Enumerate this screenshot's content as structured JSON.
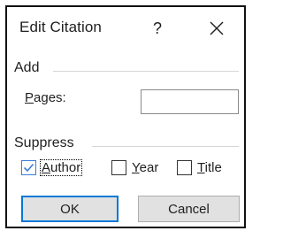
{
  "dialog": {
    "title": "Edit Citation",
    "help_label": "?",
    "close_icon": "close-icon"
  },
  "add_group": {
    "label": "Add",
    "pages": {
      "label_accel": "P",
      "label_rest": "ages:",
      "value": "",
      "placeholder": ""
    }
  },
  "suppress_group": {
    "label": "Suppress",
    "author": {
      "accel": "A",
      "rest": "uthor",
      "checked": true
    },
    "year": {
      "accel": "Y",
      "rest": "ear",
      "checked": false
    },
    "title": {
      "accel": "T",
      "rest": "itle",
      "checked": false
    }
  },
  "buttons": {
    "ok": "OK",
    "cancel": "Cancel"
  },
  "colors": {
    "accent": "#0078d7",
    "check": "#3a7dd8",
    "button_bg": "#e1e1e1"
  }
}
